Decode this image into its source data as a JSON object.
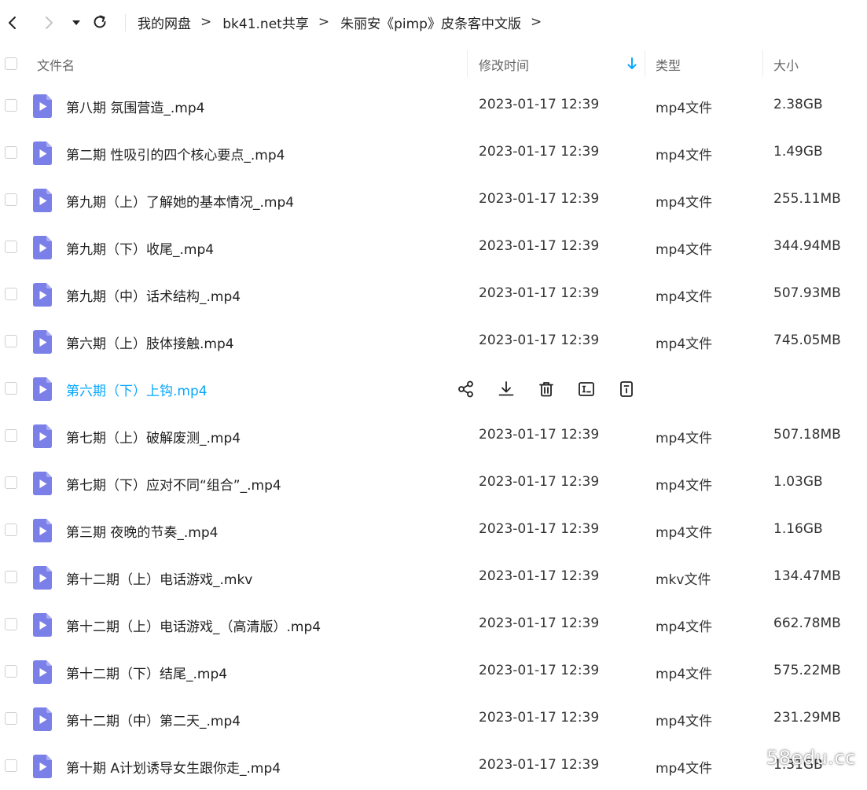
{
  "colors": {
    "accent": "#06a7ff",
    "file_icon": "#7b7fe8",
    "file_icon_fold": "#a9acf3"
  },
  "breadcrumb": [
    "我的网盘",
    "bk41.net共享",
    "朱丽安《pimp》皮条客中文版"
  ],
  "header": {
    "name": "文件名",
    "modified": "修改时间",
    "type": "类型",
    "size": "大小"
  },
  "files": [
    {
      "name": "第八期 氛围营造_.mp4",
      "modified": "2023-01-17 12:39",
      "type": "mp4文件",
      "size": "2.38GB"
    },
    {
      "name": "第二期 性吸引的四个核心要点_.mp4",
      "modified": "2023-01-17 12:39",
      "type": "mp4文件",
      "size": "1.49GB"
    },
    {
      "name": "第九期（上）了解她的基本情况_.mp4",
      "modified": "2023-01-17 12:39",
      "type": "mp4文件",
      "size": "255.11MB"
    },
    {
      "name": "第九期（下）收尾_.mp4",
      "modified": "2023-01-17 12:39",
      "type": "mp4文件",
      "size": "344.94MB"
    },
    {
      "name": "第九期（中）话术结构_.mp4",
      "modified": "2023-01-17 12:39",
      "type": "mp4文件",
      "size": "507.93MB"
    },
    {
      "name": "第六期（上）肢体接触.mp4",
      "modified": "2023-01-17 12:39",
      "type": "mp4文件",
      "size": "745.05MB"
    },
    {
      "name": "第六期（下）上钩.mp4",
      "modified": "",
      "type": "",
      "size": ""
    },
    {
      "name": "第七期（上）破解废测_.mp4",
      "modified": "2023-01-17 12:39",
      "type": "mp4文件",
      "size": "507.18MB"
    },
    {
      "name": "第七期（下）应对不同“组合”_.mp4",
      "modified": "2023-01-17 12:39",
      "type": "mp4文件",
      "size": "1.03GB"
    },
    {
      "name": "第三期 夜晚的节奏_.mp4",
      "modified": "2023-01-17 12:39",
      "type": "mp4文件",
      "size": "1.16GB"
    },
    {
      "name": "第十二期（上）电话游戏_.mkv",
      "modified": "2023-01-17 12:39",
      "type": "mkv文件",
      "size": "134.47MB"
    },
    {
      "name": "第十二期（上）电话游戏_（高清版）.mp4",
      "modified": "2023-01-17 12:39",
      "type": "mp4文件",
      "size": "662.78MB"
    },
    {
      "name": "第十二期（下）结尾_.mp4",
      "modified": "2023-01-17 12:39",
      "type": "mp4文件",
      "size": "575.22MB"
    },
    {
      "name": "第十二期（中）第二天_.mp4",
      "modified": "2023-01-17 12:39",
      "type": "mp4文件",
      "size": "231.29MB"
    },
    {
      "name": "第十期 A计划诱导女生跟你走_.mp4",
      "modified": "2023-01-17 12:39",
      "type": "mp4文件",
      "size": "1.31GB"
    }
  ],
  "watermark": "58edu.cc"
}
